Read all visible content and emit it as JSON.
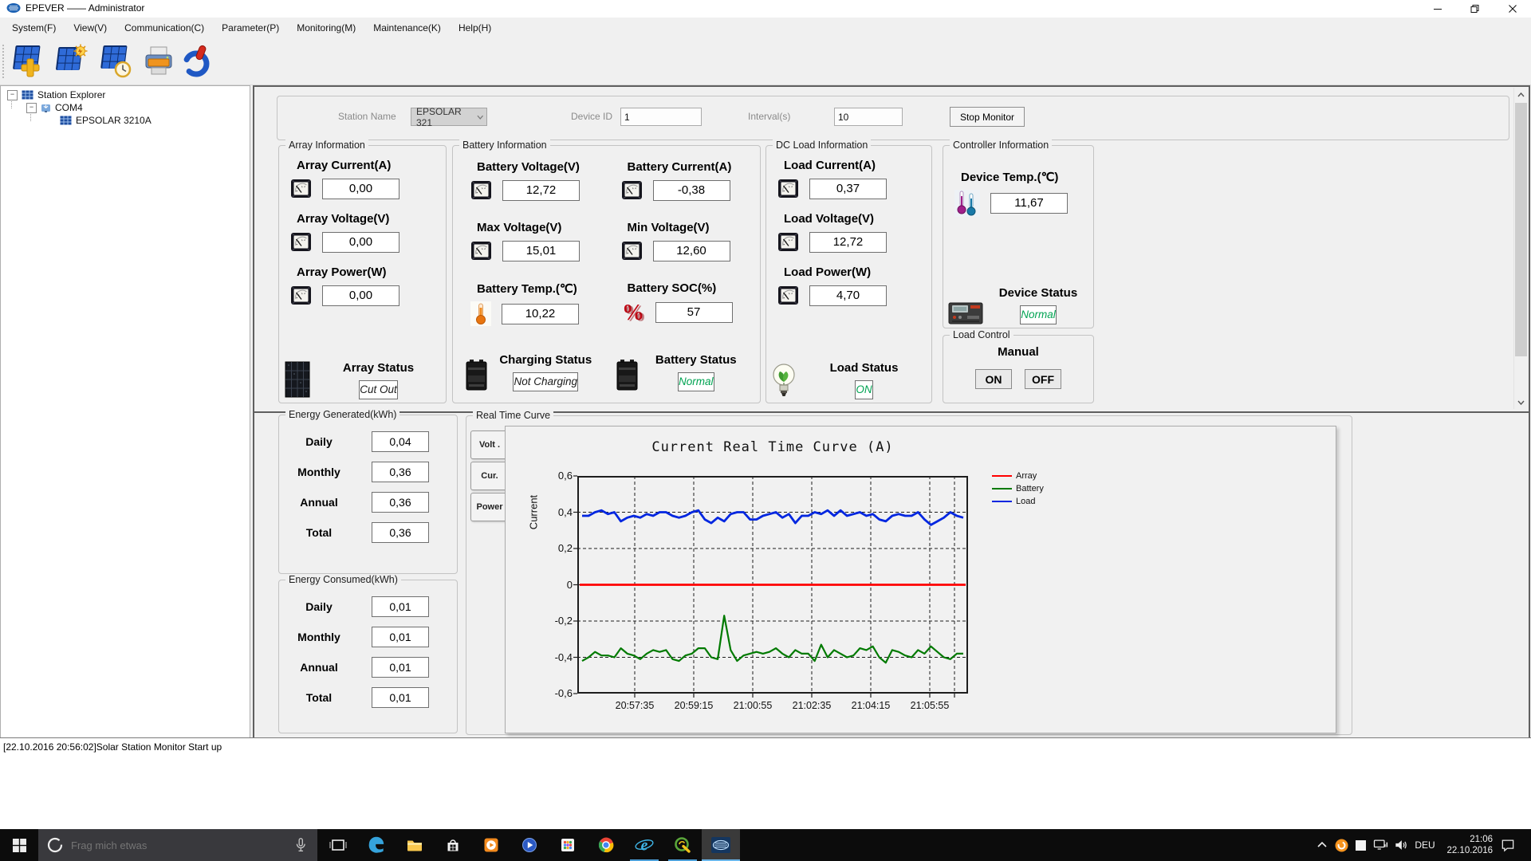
{
  "window": {
    "title": "EPEVER —— Administrator",
    "controls": [
      "minimize",
      "restore",
      "close"
    ]
  },
  "menu_bar": [
    "System(F)",
    "View(V)",
    "Communication(C)",
    "Parameter(P)",
    "Monitoring(M)",
    "Maintenance(K)",
    "Help(H)"
  ],
  "toolbar": {
    "buttons": [
      "add-station",
      "station-config",
      "realtime-monitor",
      "print",
      "power"
    ]
  },
  "tree": {
    "root": "Station Explorer",
    "port": "COM4",
    "device": "EPSOLAR 3210A"
  },
  "station_bar": {
    "station_name_label": "Station Name",
    "station_name_value": "EPSOLAR 321",
    "device_id_label": "Device ID",
    "device_id_value": "1",
    "interval_label": "Interval(s)",
    "interval_value": "10",
    "stop_button": "Stop Monitor"
  },
  "panels": {
    "array": {
      "title": "Array Information",
      "metrics": [
        {
          "label": "Array Current(A)",
          "value": "0,00",
          "icon": "meter"
        },
        {
          "label": "Array Voltage(V)",
          "value": "0,00",
          "icon": "meter"
        },
        {
          "label": "Array Power(W)",
          "value": "0,00",
          "icon": "meter"
        }
      ],
      "statuses": [
        {
          "label": "Array Status",
          "value": "Cut Out",
          "icon": "solar-panel",
          "color": "#1a1a1a"
        }
      ]
    },
    "battery": {
      "title": "Battery Information",
      "metrics": [
        {
          "label": "Battery Voltage(V)",
          "value": "12,72",
          "icon": "meter"
        },
        {
          "label": "Battery Current(A)",
          "value": "-0,38",
          "icon": "meter"
        },
        {
          "label": "Max Voltage(V)",
          "value": "15,01",
          "icon": "meter"
        },
        {
          "label": "Min Voltage(V)",
          "value": "12,60",
          "icon": "meter"
        },
        {
          "label": "Battery Temp.(℃)",
          "value": "10,22",
          "icon": "thermometer"
        },
        {
          "label": "Battery SOC(%)",
          "value": "57",
          "icon": "percent"
        }
      ],
      "statuses": [
        {
          "label": "Charging Status",
          "value": "Not Charging",
          "icon": "battery",
          "color": "#1a1a1a"
        },
        {
          "label": "Battery Status",
          "value": "Normal",
          "icon": "battery",
          "color": "#00a352"
        }
      ]
    },
    "dc_load": {
      "title": "DC Load Information",
      "metrics": [
        {
          "label": "Load Current(A)",
          "value": "0,37",
          "icon": "meter"
        },
        {
          "label": "Load Voltage(V)",
          "value": "12,72",
          "icon": "meter"
        },
        {
          "label": "Load Power(W)",
          "value": "4,70",
          "icon": "meter"
        }
      ],
      "statuses": [
        {
          "label": "Load Status",
          "value": "ON",
          "icon": "bulb",
          "color": "#00a352"
        }
      ]
    },
    "controller": {
      "title": "Controller Information",
      "metrics": [
        {
          "label": "Device Temp.(℃)",
          "value": "11,67",
          "icon": "dual-thermometer"
        }
      ],
      "statuses": [
        {
          "label": "Device Status",
          "value": "Normal",
          "icon": "controller",
          "color": "#00a352"
        }
      ]
    },
    "load_control": {
      "title": "Load Control",
      "mode_label": "Manual",
      "on_label": "ON",
      "off_label": "OFF"
    },
    "energy_generated": {
      "title": "Energy Generated(kWh)",
      "rows": [
        {
          "label": "Daily",
          "value": "0,04"
        },
        {
          "label": "Monthly",
          "value": "0,36"
        },
        {
          "label": "Annual",
          "value": "0,36"
        },
        {
          "label": "Total",
          "value": "0,36"
        }
      ]
    },
    "energy_consumed": {
      "title": "Energy Consumed(kWh)",
      "rows": [
        {
          "label": "Daily",
          "value": "0,01"
        },
        {
          "label": "Monthly",
          "value": "0,01"
        },
        {
          "label": "Annual",
          "value": "0,01"
        },
        {
          "label": "Total",
          "value": "0,01"
        }
      ]
    }
  },
  "curve": {
    "title": "Real Time Curve",
    "tabs": [
      "Volt .",
      "Cur.",
      "Power"
    ]
  },
  "chart_data": {
    "type": "line",
    "title": "Current Real Time Curve (A)",
    "ylabel": "Current",
    "ylim": [
      -0.6,
      0.6
    ],
    "yticks": [
      "0,6",
      "0,4",
      "0,2",
      "0",
      "-0,2",
      "-0,4",
      "-0,6"
    ],
    "x_ticklabels": [
      "20:57:35",
      "20:59:15",
      "21:00:55",
      "21:02:35",
      "21:04:15",
      "21:05:55"
    ],
    "grid": "dashed",
    "legend_position": "right",
    "legend": [
      {
        "name": "Array",
        "color": "#ff0000"
      },
      {
        "name": "Battery",
        "color": "#007a00"
      },
      {
        "name": "Load",
        "color": "#0026e0"
      }
    ],
    "series": [
      {
        "name": "Array",
        "color": "#ff0000",
        "values": [
          0,
          0
        ]
      },
      {
        "name": "Battery",
        "color": "#007a00",
        "values": [
          -0.42,
          -0.4,
          -0.37,
          -0.39,
          -0.39,
          -0.4,
          -0.35,
          -0.38,
          -0.39,
          -0.41,
          -0.38,
          -0.36,
          -0.37,
          -0.36,
          -0.41,
          -0.42,
          -0.39,
          -0.38,
          -0.35,
          -0.35,
          -0.4,
          -0.41,
          -0.17,
          -0.36,
          -0.42,
          -0.39,
          -0.38,
          -0.37,
          -0.38,
          -0.37,
          -0.35,
          -0.38,
          -0.4,
          -0.36,
          -0.38,
          -0.38,
          -0.42,
          -0.33,
          -0.4,
          -0.36,
          -0.38,
          -0.4,
          -0.39,
          -0.35,
          -0.36,
          -0.34,
          -0.4,
          -0.43,
          -0.36,
          -0.37,
          -0.39,
          -0.4,
          -0.36,
          -0.38,
          -0.34,
          -0.37,
          -0.4,
          -0.41,
          -0.38,
          -0.38
        ]
      },
      {
        "name": "Load",
        "color": "#0026e0",
        "values": [
          0.38,
          0.38,
          0.4,
          0.41,
          0.39,
          0.4,
          0.35,
          0.37,
          0.38,
          0.37,
          0.39,
          0.38,
          0.4,
          0.4,
          0.38,
          0.37,
          0.38,
          0.4,
          0.41,
          0.36,
          0.34,
          0.37,
          0.35,
          0.39,
          0.4,
          0.4,
          0.36,
          0.36,
          0.38,
          0.39,
          0.4,
          0.37,
          0.39,
          0.34,
          0.38,
          0.38,
          0.4,
          0.39,
          0.41,
          0.38,
          0.41,
          0.38,
          0.39,
          0.4,
          0.38,
          0.39,
          0.36,
          0.35,
          0.38,
          0.39,
          0.38,
          0.38,
          0.4,
          0.36,
          0.33,
          0.35,
          0.37,
          0.4,
          0.38,
          0.37
        ]
      }
    ]
  },
  "status_log": "[22.10.2016 20:56:02]Solar Station Monitor Start up",
  "taskbar": {
    "search_placeholder": "Frag mich etwas",
    "language": "DEU",
    "time": "21:06",
    "date": "22.10.2016",
    "apps": [
      "task-view",
      "edge",
      "file-explorer",
      "store",
      "media-player",
      "movies-app",
      "apps-grid",
      "chrome",
      "internet-explorer",
      "solar-app",
      "epever-monitor"
    ],
    "running_apps": [
      "internet-explorer",
      "solar-app",
      "epever-monitor"
    ],
    "active_app": "epever-monitor"
  }
}
